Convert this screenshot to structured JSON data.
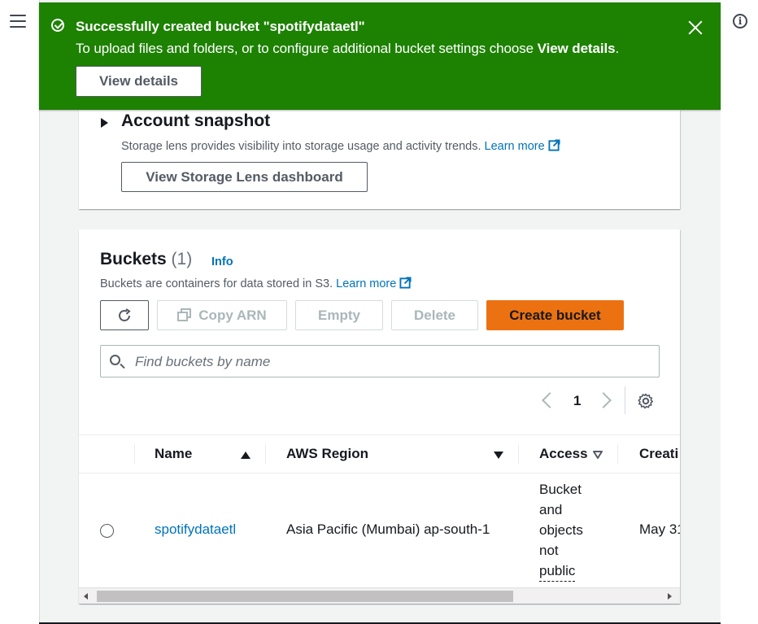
{
  "flash": {
    "title": "Successfully created bucket \"spotifydataetl\"",
    "message_prefix": "To upload files and folders, or to configure additional bucket settings choose ",
    "message_bold": "View details",
    "message_suffix": ".",
    "button_label": "View details",
    "color": "#1d8102"
  },
  "account_snapshot": {
    "title": "Account snapshot",
    "description": "Storage lens provides visibility into storage usage and activity trends.",
    "learn_more": "Learn more",
    "button_label": "View Storage Lens dashboard"
  },
  "buckets": {
    "title": "Buckets",
    "count": "(1)",
    "info": "Info",
    "description": "Buckets are containers for data stored in S3.",
    "learn_more": "Learn more",
    "toolbar": {
      "copy_arn": "Copy ARN",
      "empty": "Empty",
      "delete": "Delete",
      "create": "Create bucket",
      "create_color": "#ec7211"
    },
    "search": {
      "placeholder": "Find buckets by name",
      "value": ""
    },
    "pagination": {
      "current_page": "1"
    },
    "columns": [
      "Name",
      "AWS Region",
      "Access",
      "Creati"
    ],
    "rows": [
      {
        "name": "spotifydataetl",
        "region": "Asia Pacific (Mumbai) ap-south-1",
        "access_lines": [
          "Bucket",
          "and",
          "objects",
          "not",
          "public"
        ],
        "created": "May 31"
      }
    ]
  },
  "icons": {
    "menu": "hamburger-icon",
    "help": "info-icon",
    "success": "check-circle-icon",
    "close": "close-icon",
    "external": "external-link-icon",
    "refresh": "refresh-icon",
    "copy": "copy-icon",
    "search": "search-icon",
    "settings": "gear-icon"
  }
}
